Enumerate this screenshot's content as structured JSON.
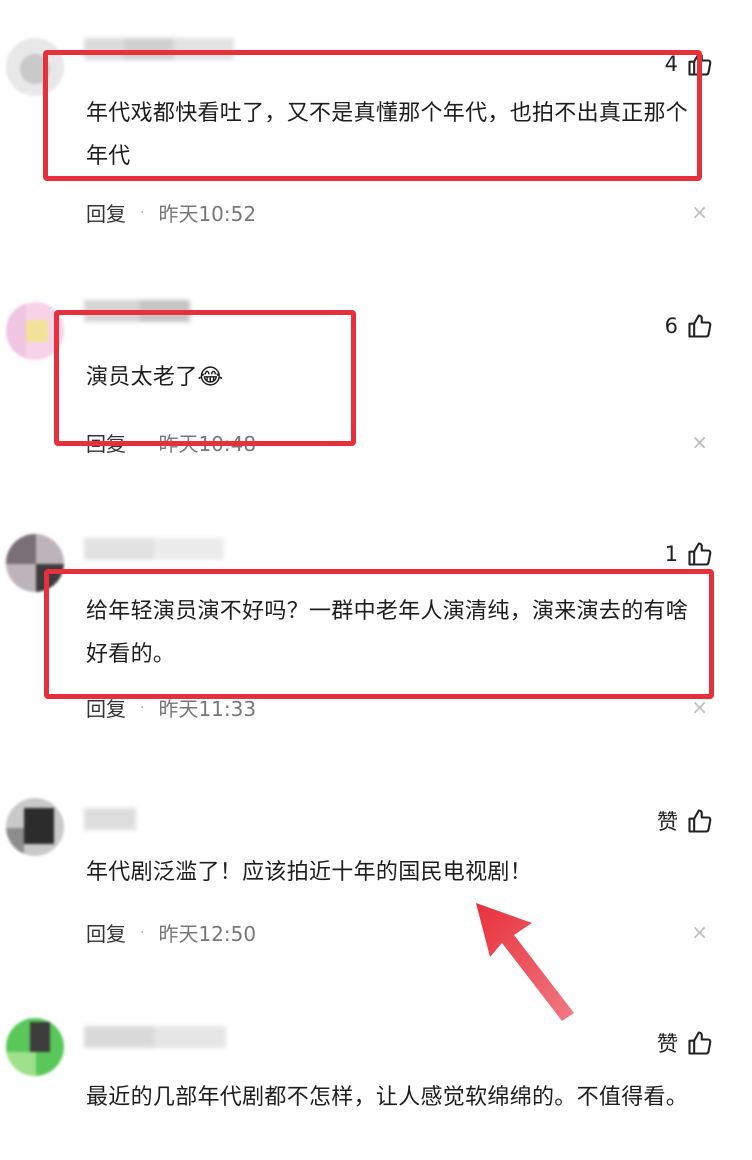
{
  "comments": [
    {
      "like_count": "4",
      "text": "年代戏都快看吐了，又不是真懂那个年代，也拍不出真正那个年代",
      "reply_label": "回复",
      "time": "昨天10:52"
    },
    {
      "like_count": "6",
      "text": "演员太老了😂",
      "reply_label": "回复",
      "time": "昨天10:48"
    },
    {
      "like_count": "1",
      "text": "给年轻演员演不好吗？一群中老年人演清纯，演来演去的有啥好看的。",
      "reply_label": "回复",
      "time": "昨天11:33"
    },
    {
      "like_count": "赞",
      "text": "年代剧泛滥了！应该拍近十年的国民电视剧！",
      "reply_label": "回复",
      "time": "昨天12:50"
    },
    {
      "like_count": "赞",
      "text": "最近的几部年代剧都不怎样，让人感觉软绵绵的。不值得看。"
    }
  ],
  "meta_separator": "·",
  "close_glyph": "×",
  "icons": {
    "like": "thumbs-up-icon",
    "close": "close-icon",
    "arrow": "red-arrow-annotation"
  },
  "colors": {
    "highlight": "#e8303c",
    "text": "#1d1d1d",
    "meta": "#777777"
  }
}
